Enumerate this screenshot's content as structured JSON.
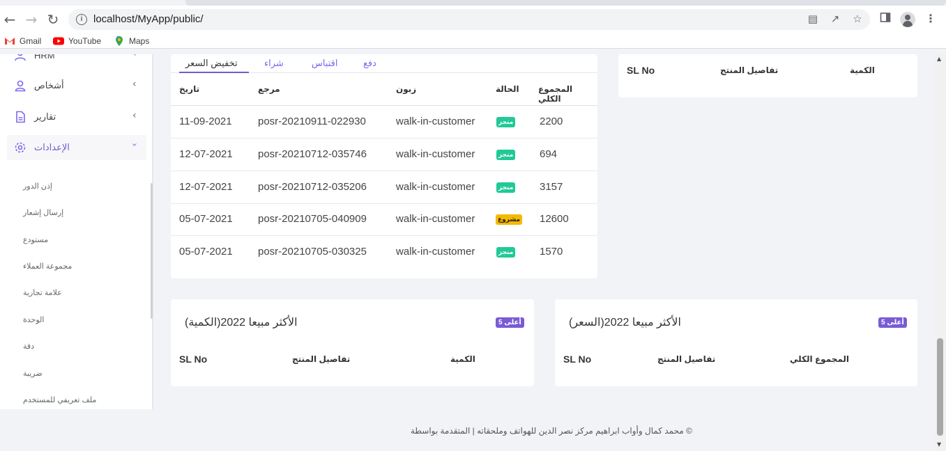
{
  "browser": {
    "url": "localhost/MyApp/public/",
    "bookmarks": [
      {
        "label": "Gmail",
        "icon": "gmail-icon"
      },
      {
        "label": "YouTube",
        "icon": "youtube-icon"
      },
      {
        "label": "Maps",
        "icon": "maps-icon"
      }
    ]
  },
  "sidebar": {
    "partial_top": "HRM",
    "items": [
      {
        "label": "أشخاص",
        "icon": "user-icon"
      },
      {
        "label": "تقارير",
        "icon": "file-icon"
      },
      {
        "label": "الإعدادات",
        "icon": "gear-icon"
      }
    ],
    "submenu": [
      "إذن الدور",
      "إرسال إشعار",
      "مستودع",
      "مجموعة العملاء",
      "علامة تجارية",
      "الوحدة",
      "دقة",
      "ضريبة",
      "ملف تعريفي للمستخدم"
    ]
  },
  "transactions": {
    "tabs": [
      "دفع",
      "اقتباس",
      "شراء",
      "تخفيض السعر"
    ],
    "columns": {
      "date": "تاريخ",
      "reference": "مرجع",
      "customer": "زبون",
      "status": "الحالة",
      "grand_total": "المجموع الكلي"
    },
    "rows": [
      {
        "date": "11-09-2021",
        "reference": "posr-20210911-022930",
        "customer": "walk-in-customer",
        "status": "منجز",
        "total": "2200"
      },
      {
        "date": "12-07-2021",
        "reference": "posr-20210712-035746",
        "customer": "walk-in-customer",
        "status": "منجز",
        "total": "694"
      },
      {
        "date": "12-07-2021",
        "reference": "posr-20210712-035206",
        "customer": "walk-in-customer",
        "status": "منجز",
        "total": "3157"
      },
      {
        "date": "05-07-2021",
        "reference": "posr-20210705-040909",
        "customer": "walk-in-customer",
        "status": "مشروع",
        "total": "12600"
      },
      {
        "date": "05-07-2021",
        "reference": "posr-20210705-030325",
        "customer": "walk-in-customer",
        "status": "منجز",
        "total": "1570"
      }
    ]
  },
  "top_right_card": {
    "sl_no": "SL No",
    "product_details": "تفاصيل المنتج",
    "quantity": "الكمية"
  },
  "best_qty_card": {
    "title": "الأكثر مبيعا 2022(الكمية)",
    "badge": "أعلى 5",
    "sl_no": "SL No",
    "product_details": "تفاصيل المنتج",
    "quantity": "الكمية"
  },
  "best_price_card": {
    "title": "الأكثر مبيعا 2022(السعر)",
    "badge": "أعلى 5",
    "sl_no": "SL No",
    "product_details": "تفاصيل المنتج",
    "grand_total": "المجموع الكلي"
  },
  "footer": {
    "text": "محمد كمال وأواب ابراهيم مركز نصر الدين للهواتف وملحقاته | المتقدمة بواسطة ©"
  },
  "colors": {
    "accent": "#6d5bd0",
    "success": "#20c997",
    "warning": "#f5b800",
    "badge": "#7a5bd6"
  }
}
